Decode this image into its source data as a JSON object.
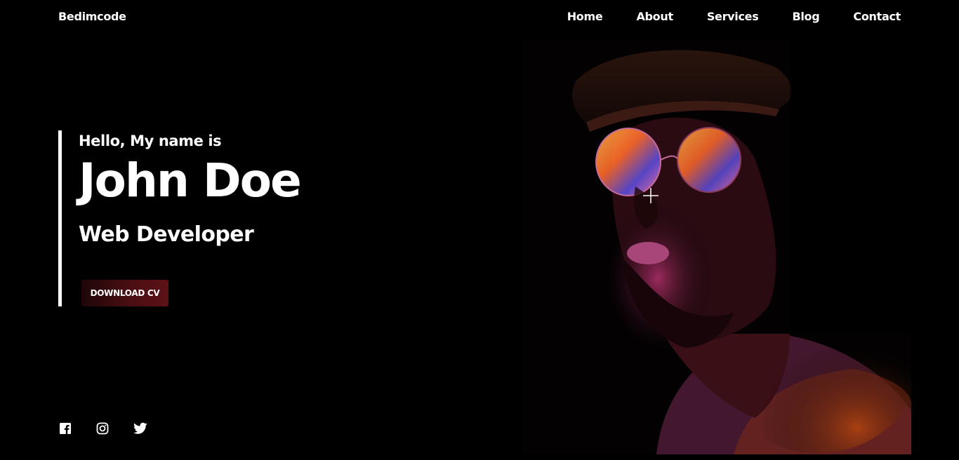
{
  "brand": "Bedimcode",
  "nav": {
    "home": "Home",
    "about": "About",
    "services": "Services",
    "blog": "Blog",
    "contact": "Contact"
  },
  "hero": {
    "greeting": "Hello, My name is",
    "name": "John Doe",
    "role": "Web Developer",
    "cta_label": "DOWNLOAD CV"
  },
  "socials": {
    "icons": [
      "facebook-icon",
      "instagram-icon",
      "twitter-icon"
    ]
  },
  "colors": {
    "background": "#000000",
    "text": "#ffffff",
    "button_gradient_start": "#1e0608",
    "button_gradient_end": "#5c1216"
  }
}
